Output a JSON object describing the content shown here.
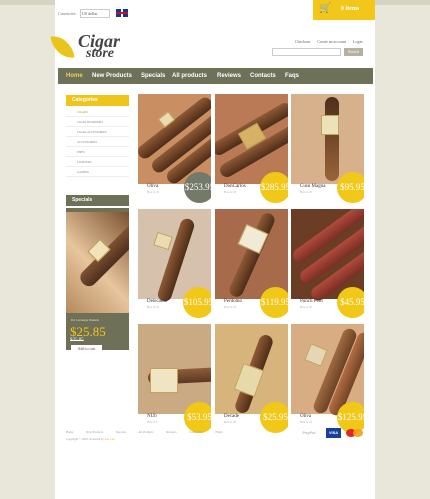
{
  "currency": {
    "label": "Currencies:",
    "value": "US dollar"
  },
  "cart": {
    "label": "0 items"
  },
  "logo": {
    "line1": "Cigar",
    "line2": "store"
  },
  "account": {
    "links": [
      "Checkout",
      "Create an account",
      "Login"
    ]
  },
  "search": {
    "button": "Search"
  },
  "nav": [
    "Home",
    "New Products",
    "Specials",
    "All products",
    "Reviews",
    "Contacts",
    "Faqs"
  ],
  "categories": {
    "title": "Categories",
    "items": [
      "CIGARS",
      "CIGAR HUMIDORS",
      "CIGAR ACCESSORIES",
      "ACCESSORIES",
      "PIPES",
      "LIGHTERS",
      "GAMING"
    ]
  },
  "specials": {
    "title": "Specials",
    "product": "Por Larranaga Panetela",
    "price": "$25.85",
    "old_price": "$35.85",
    "button": "Add to cart"
  },
  "products": [
    {
      "name": "Oliva",
      "meta": "Box of 25",
      "price": "$253.95",
      "badge": "dark"
    },
    {
      "name": "DonCarlos",
      "meta": "Box of 25",
      "price": "$285.95",
      "badge": "gold"
    },
    {
      "name": "Cusu Magna",
      "meta": "Box of 25",
      "price": "$95.95",
      "badge": "gold"
    },
    {
      "name": "Delecanio",
      "meta": "Box of 25",
      "price": "$105.95",
      "badge": "gold"
    },
    {
      "name": "Perdomo",
      "meta": "Box of 25",
      "price": "$119.95",
      "badge": "gold"
    },
    {
      "name": "Punch Petit",
      "meta": "Box of 25",
      "price": "$45.95",
      "badge": "gold"
    },
    {
      "name": "NUb",
      "meta": "Box of 5",
      "price": "$53.95",
      "badge": "gold"
    },
    {
      "name": "Decade",
      "meta": "Box of 20",
      "price": "$25.95",
      "badge": "gold"
    },
    {
      "name": "Oliva",
      "meta": "Box of 25",
      "price": "$125.95",
      "badge": "gold"
    }
  ],
  "footer": {
    "links": [
      "Home",
      "New Products",
      "Specials",
      "All Products",
      "Reviews",
      "Contact Us",
      "FAQs"
    ],
    "copyright": "Copyright © 2010. Powered by",
    "brand": "Zen Cart"
  },
  "payment": {
    "paypal": "PayPal",
    "visa": "VISA"
  }
}
